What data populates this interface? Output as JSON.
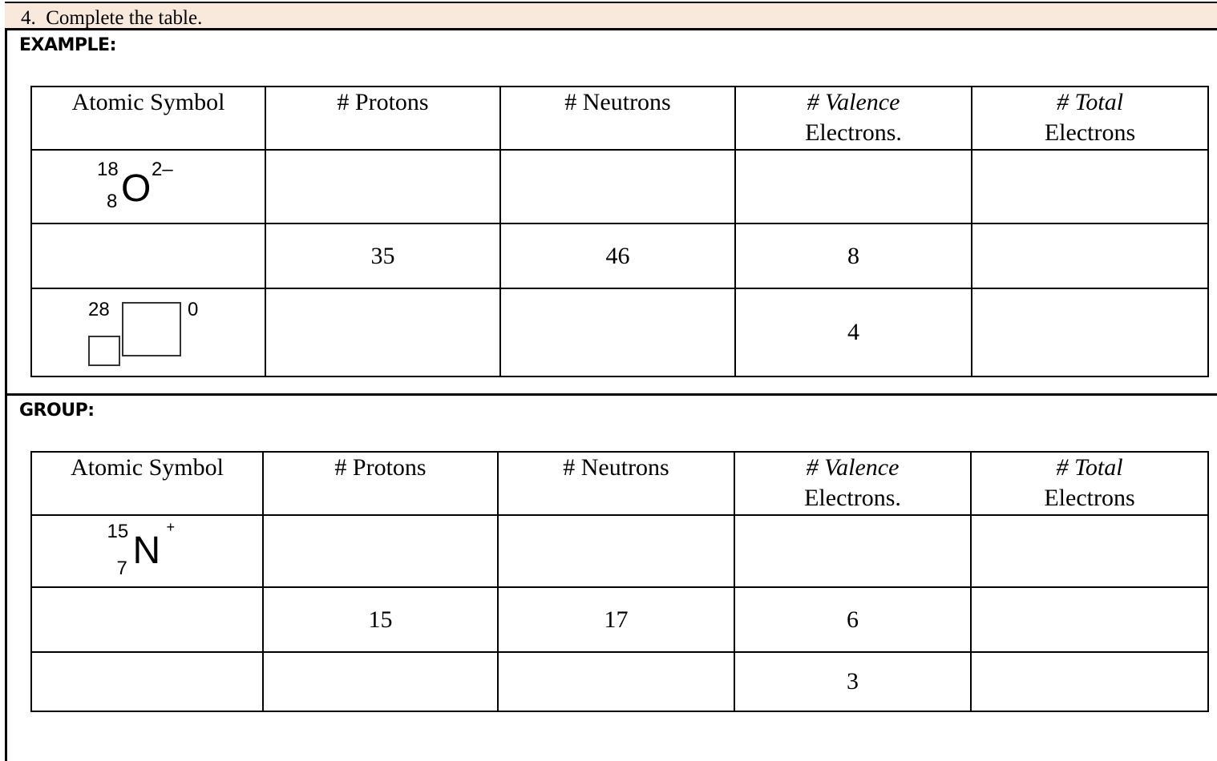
{
  "question": {
    "number": "4.",
    "text": "Complete the table."
  },
  "colors": {
    "header_bg": "#f8e9dc"
  },
  "example": {
    "label": "EXAMPLE:",
    "headers": [
      {
        "italic": "# Valence",
        "plain": ""
      },
      {
        "plain": "# Protons"
      },
      {
        "plain": "# Neutrons"
      },
      {
        "italic": "# Valence",
        "plain": "Electrons."
      },
      {
        "italic": "# Total",
        "plain": "Electrons"
      }
    ],
    "header_atomic": "Atomic Symbol",
    "rows": [
      {
        "symbol": {
          "mass": "18",
          "number": "8",
          "element": "O",
          "charge": "2–"
        },
        "protons": "",
        "neutrons": "",
        "valence": "",
        "total": ""
      },
      {
        "symbol": null,
        "protons": "35",
        "neutrons": "46",
        "valence": "8",
        "total": ""
      },
      {
        "symbol": {
          "mass": "28",
          "number": "",
          "element": "",
          "charge": "0",
          "blanks": true
        },
        "protons": "",
        "neutrons": "",
        "valence": "4",
        "total": ""
      }
    ]
  },
  "group": {
    "label": "GROUP:",
    "header_atomic": "Atomic Symbol",
    "header_protons": "# Protons",
    "header_neutrons": "# Neutrons",
    "header_valence_italic": "# Valence",
    "header_valence_plain": "Electrons.",
    "header_total_italic": "# Total",
    "header_total_plain": "Electrons",
    "rows": [
      {
        "symbol": {
          "mass": "15",
          "number": "7",
          "element": "N",
          "charge": "+"
        },
        "protons": "",
        "neutrons": "",
        "valence": "",
        "total": ""
      },
      {
        "protons": "15",
        "neutrons": "17",
        "valence": "6",
        "total": ""
      },
      {
        "protons": "",
        "neutrons": "",
        "valence": "3",
        "total": ""
      }
    ]
  },
  "headers": {
    "atomic": "Atomic Symbol",
    "protons": "# Protons",
    "neutrons": "# Neutrons",
    "valence_italic": "# Valence",
    "valence_plain": "Electrons.",
    "total_italic": "# Total",
    "total_plain": "Electrons"
  }
}
